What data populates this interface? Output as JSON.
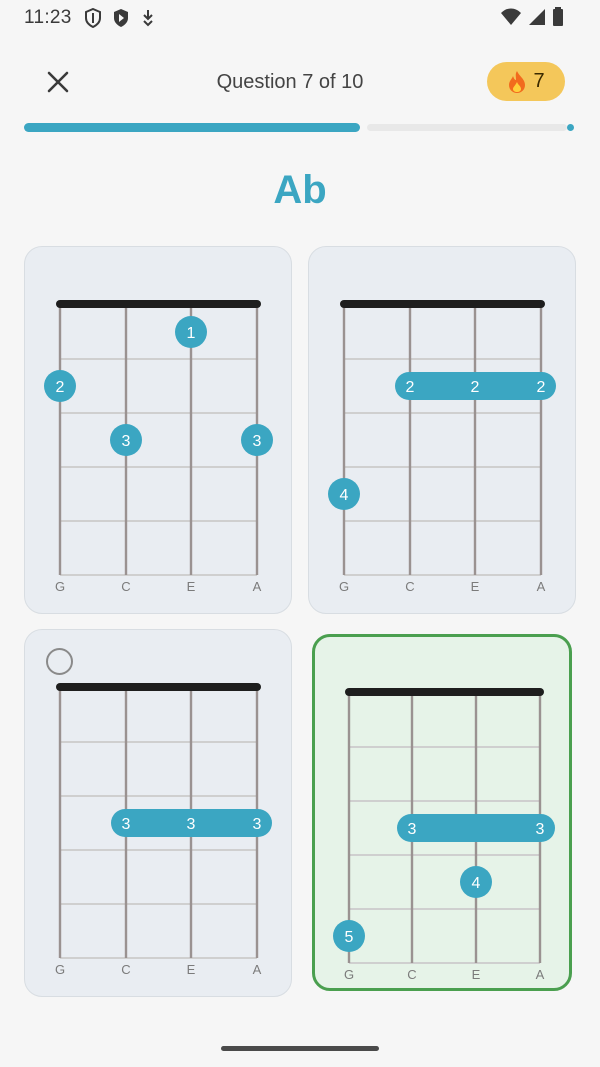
{
  "status_bar": {
    "time": "11:23",
    "left_icons": [
      "shield-icon",
      "play-shield-icon",
      "download-icon"
    ],
    "right_icons": [
      "wifi-icon",
      "signal-icon",
      "battery-icon"
    ]
  },
  "header": {
    "close_icon": "close-icon",
    "question_label": "Question 7 of 10",
    "streak": {
      "icon": "fire-icon",
      "count": "7"
    }
  },
  "progress": {
    "value": 0.7,
    "accent": "#3ba6c2"
  },
  "chord_name": "Ab",
  "colors": {
    "accent": "#3ba6c2",
    "selected_border": "#4a9f4f",
    "card_bg": "#e9edf2"
  },
  "options": [
    {
      "strings": [
        "G",
        "C",
        "E",
        "A"
      ],
      "selected": false,
      "show_radio": false,
      "fingers": [
        {
          "string": 2,
          "fret": 1,
          "label": "1"
        },
        {
          "string": 0,
          "fret": 2,
          "label": "2"
        },
        {
          "string": 1,
          "fret": 3,
          "label": "3"
        },
        {
          "string": 3,
          "fret": 3,
          "label": "3"
        }
      ],
      "barres": []
    },
    {
      "strings": [
        "G",
        "C",
        "E",
        "A"
      ],
      "selected": false,
      "show_radio": false,
      "fingers": [
        {
          "string": 0,
          "fret": 4,
          "label": "4"
        }
      ],
      "barres": [
        {
          "from": 1,
          "to": 3,
          "fret": 2,
          "labels": [
            "2",
            "2",
            "2"
          ]
        }
      ]
    },
    {
      "strings": [
        "G",
        "C",
        "E",
        "A"
      ],
      "selected": false,
      "show_radio": true,
      "fingers": [],
      "barres": [
        {
          "from": 1,
          "to": 3,
          "fret": 3,
          "labels": [
            "3",
            "3",
            "3"
          ]
        }
      ]
    },
    {
      "strings": [
        "G",
        "C",
        "E",
        "A"
      ],
      "selected": true,
      "show_radio": false,
      "fingers": [
        {
          "string": 2,
          "fret": 4,
          "label": "4"
        },
        {
          "string": 0,
          "fret": 5,
          "label": "5"
        }
      ],
      "barres": [
        {
          "from": 1,
          "to": 3,
          "fret": 3,
          "labels": [
            "3",
            "3"
          ]
        }
      ]
    }
  ]
}
